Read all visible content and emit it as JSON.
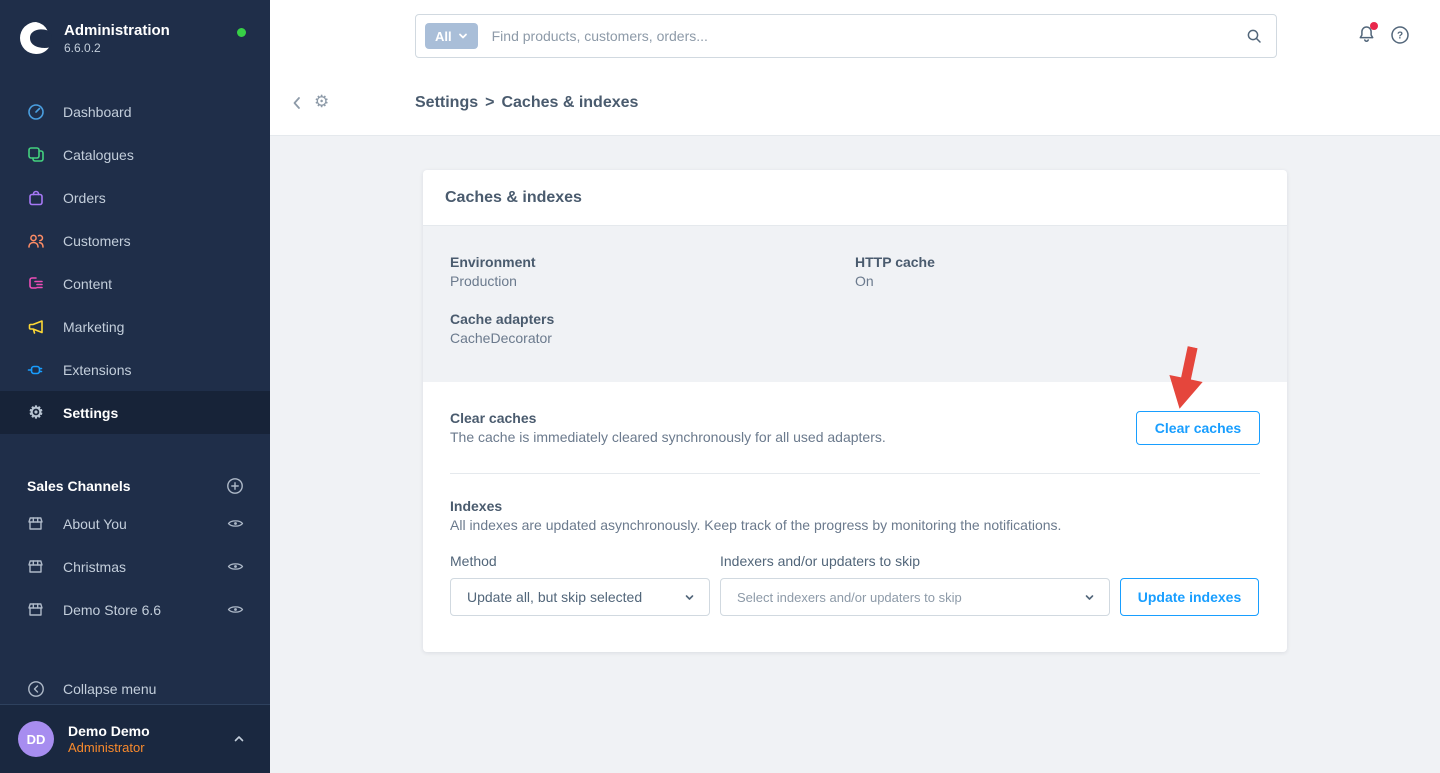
{
  "colors": {
    "accent_blue": "#189eff",
    "sidebar_bg": "#1f2e49",
    "sidebar_active_bg": "#172338",
    "status_green": "#37d046",
    "role_orange": "#f98a2c",
    "avatar_purple": "#a78df0",
    "annotation_red": "#e5463c",
    "notification_red": "#e8274b",
    "page_bg": "#f0f2f5"
  },
  "sidebar": {
    "app_title": "Administration",
    "version": "6.6.0.2",
    "status_dot": "online-green",
    "nav": [
      {
        "label": "Dashboard",
        "icon": "dashboard-gauge-icon",
        "color": "#4a9fe0"
      },
      {
        "label": "Catalogues",
        "icon": "catalogues-icon",
        "color": "#43d17f"
      },
      {
        "label": "Orders",
        "icon": "orders-bag-icon",
        "color": "#a678f5"
      },
      {
        "label": "Customers",
        "icon": "customers-icon",
        "color": "#ff8d66"
      },
      {
        "label": "Content",
        "icon": "content-layout-icon",
        "color": "#ed4db7"
      },
      {
        "label": "Marketing",
        "icon": "megaphone-icon",
        "color": "#fdd835"
      },
      {
        "label": "Extensions",
        "icon": "plug-icon",
        "color": "#189eff"
      },
      {
        "label": "Settings",
        "icon": "gear-icon",
        "color": "#b8c4d2",
        "active": true
      }
    ],
    "sales_channels": {
      "header": "Sales Channels",
      "add_icon": "plus-circle-icon",
      "items": [
        {
          "label": "About You",
          "icon": "storefront-icon",
          "visibility_icon": "eye-icon"
        },
        {
          "label": "Christmas",
          "icon": "storefront-icon",
          "visibility_icon": "eye-icon"
        },
        {
          "label": "Demo Store 6.6",
          "icon": "storefront-icon",
          "visibility_icon": "eye-icon"
        }
      ]
    },
    "collapse_label": "Collapse menu",
    "user": {
      "initials": "DD",
      "name": "Demo Demo",
      "role": "Administrator"
    }
  },
  "topbar": {
    "search_scope": "All",
    "search_placeholder": "Find products, customers, orders...",
    "icons": [
      "search-icon",
      "bell-icon",
      "help-icon"
    ]
  },
  "breadcrumb": {
    "module_icon": "gear-icon",
    "section": "Settings",
    "separator": ">",
    "current": "Caches & indexes"
  },
  "card": {
    "title": "Caches & indexes",
    "info": [
      {
        "label": "Environment",
        "value": "Production"
      },
      {
        "label": "HTTP cache",
        "value": "On"
      },
      {
        "label": "Cache adapters",
        "value": "CacheDecorator"
      }
    ],
    "clear_caches": {
      "label": "Clear caches",
      "description": "The cache is immediately cleared synchronously for all used adapters.",
      "button_label": "Clear caches"
    },
    "indexes": {
      "label": "Indexes",
      "description": "All indexes are updated asynchronously. Keep track of the progress by monitoring the notifications.",
      "method_label": "Method",
      "method_value": "Update all, but skip selected",
      "skip_label": "Indexers and/or updaters to skip",
      "skip_placeholder": "Select indexers and/or updaters to skip",
      "button_label": "Update indexes"
    }
  },
  "annotation": {
    "shape": "red-arrow-pointing-at-clear-caches-button"
  }
}
